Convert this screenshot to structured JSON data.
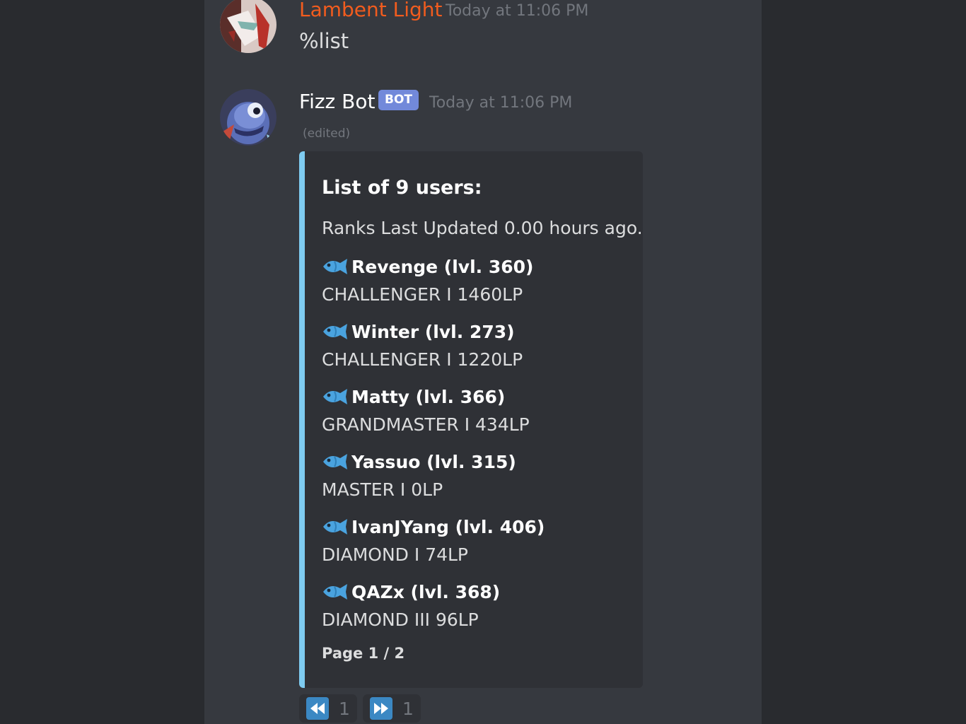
{
  "colors": {
    "sidebar_bg": "#292b2f",
    "chat_bg": "#36393f",
    "embed_bg": "#2f3136",
    "embed_accent": "#7ecbf0",
    "author_orange": "#f25c1e",
    "bot_tag": "#7289da",
    "timestamp": "#72767d"
  },
  "messages": [
    {
      "author": "Lambent Light",
      "timestamp": "Today at 11:06 PM",
      "text": "%list",
      "avatar": "lambent-avatar"
    },
    {
      "author": "Fizz Bot",
      "bot_tag": "BOT",
      "timestamp": "Today at 11:06 PM",
      "edited": "(edited)",
      "avatar": "fizz-avatar",
      "embed": {
        "title": "List of 9 users:",
        "description": "Ranks Last Updated 0.00 hours ago.",
        "fields": [
          {
            "icon": "fish-icon",
            "name": "Revenge (lvl. 360)",
            "value": "CHALLENGER I 1460LP"
          },
          {
            "icon": "fish-icon",
            "name": "Winter (lvl. 273)",
            "value": "CHALLENGER I 1220LP"
          },
          {
            "icon": "fish-icon",
            "name": "Matty (lvl. 366)",
            "value": "GRANDMASTER I 434LP"
          },
          {
            "icon": "fish-icon",
            "name": "Yassuo (lvl. 315)",
            "value": "MASTER I 0LP"
          },
          {
            "icon": "fish-icon",
            "name": "IvanJYang (lvl. 406)",
            "value": "DIAMOND I 74LP"
          },
          {
            "icon": "fish-icon",
            "name": "QAZx (lvl. 368)",
            "value": "DIAMOND III 96LP"
          }
        ],
        "footer": "Page 1 / 2"
      },
      "reactions": [
        {
          "icon": "rewind-icon",
          "count": "1"
        },
        {
          "icon": "fast-forward-icon",
          "count": "1"
        }
      ]
    }
  ]
}
